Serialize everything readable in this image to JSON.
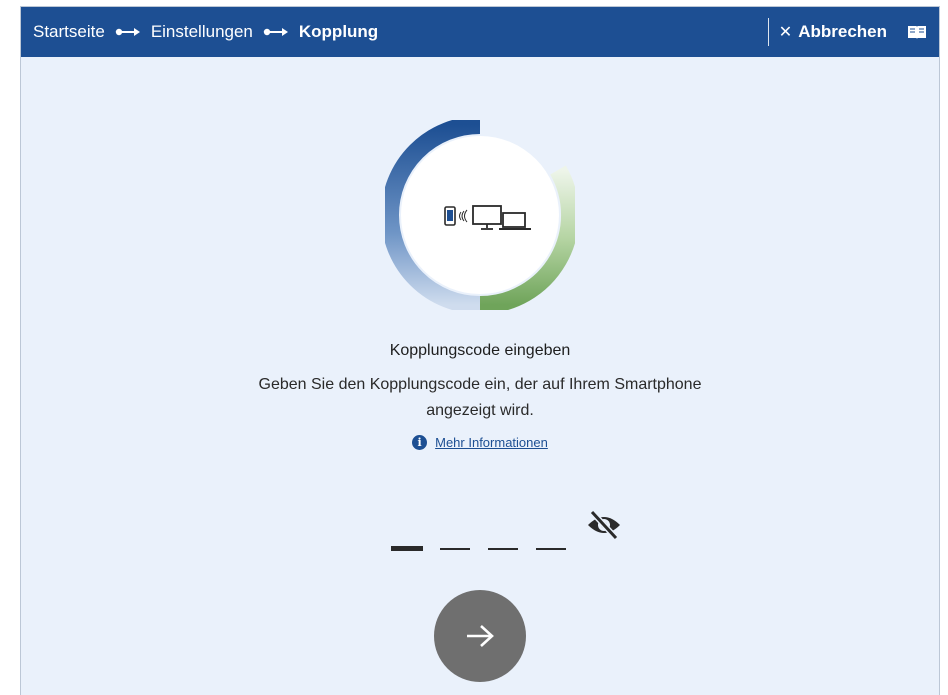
{
  "breadcrumb": {
    "items": [
      {
        "label": "Startseite"
      },
      {
        "label": "Einstellungen"
      },
      {
        "label": "Kopplung"
      }
    ]
  },
  "toolbar": {
    "cancel_label": "Abbrechen",
    "cancel_icon": "close-icon",
    "manual_icon": "book-icon"
  },
  "main": {
    "title": "Kopplungscode eingeben",
    "description_line1": "Geben Sie den Kopplungscode ein, der auf Ihrem Smartphone",
    "description_line2": "angezeigt wird.",
    "more_info_label": "Mehr Informationen",
    "code_slots": 4,
    "active_slot": 1
  },
  "colors": {
    "topbar": "#1d4f93",
    "background": "#eaf1fb",
    "ring_blue": "#1d4f93",
    "ring_green": "#7fb069",
    "next_button": "#6f6f6f"
  }
}
